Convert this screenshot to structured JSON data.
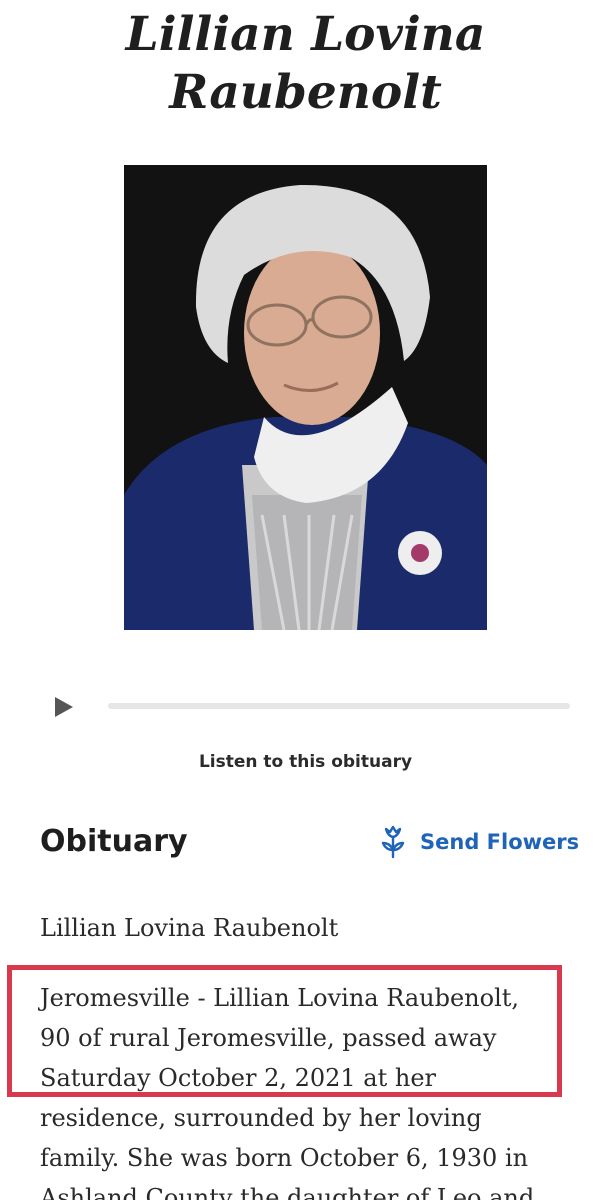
{
  "header": {
    "title": "Lillian Lovina\nRaubenolt"
  },
  "portrait": {
    "background_color": "#121212",
    "jacket_color": "#1b2a6b",
    "hair_color": "#dcdcdc"
  },
  "audio_player": {
    "play_icon": "play-icon",
    "progress_fraction": 0,
    "listen_label": "Listen to this obituary"
  },
  "obituary": {
    "heading": "Obituary",
    "send_flowers_label": "Send Flowers",
    "send_flowers_icon": "flower-icon",
    "accent_color": "#1f64b8",
    "name_line": "Lillian Lovina Raubenolt",
    "lines": [
      "Jeromesville - Lillian Lovina Raubenolt,",
      "90 of rural Jeromesville, passed away",
      "Saturday October 2, 2021 at her",
      "residence, surrounded by her loving",
      "family. She was born October 6, 1930 in",
      "Ashland County the daughter of Leo and"
    ],
    "highlight_color": "#d83a4d"
  }
}
